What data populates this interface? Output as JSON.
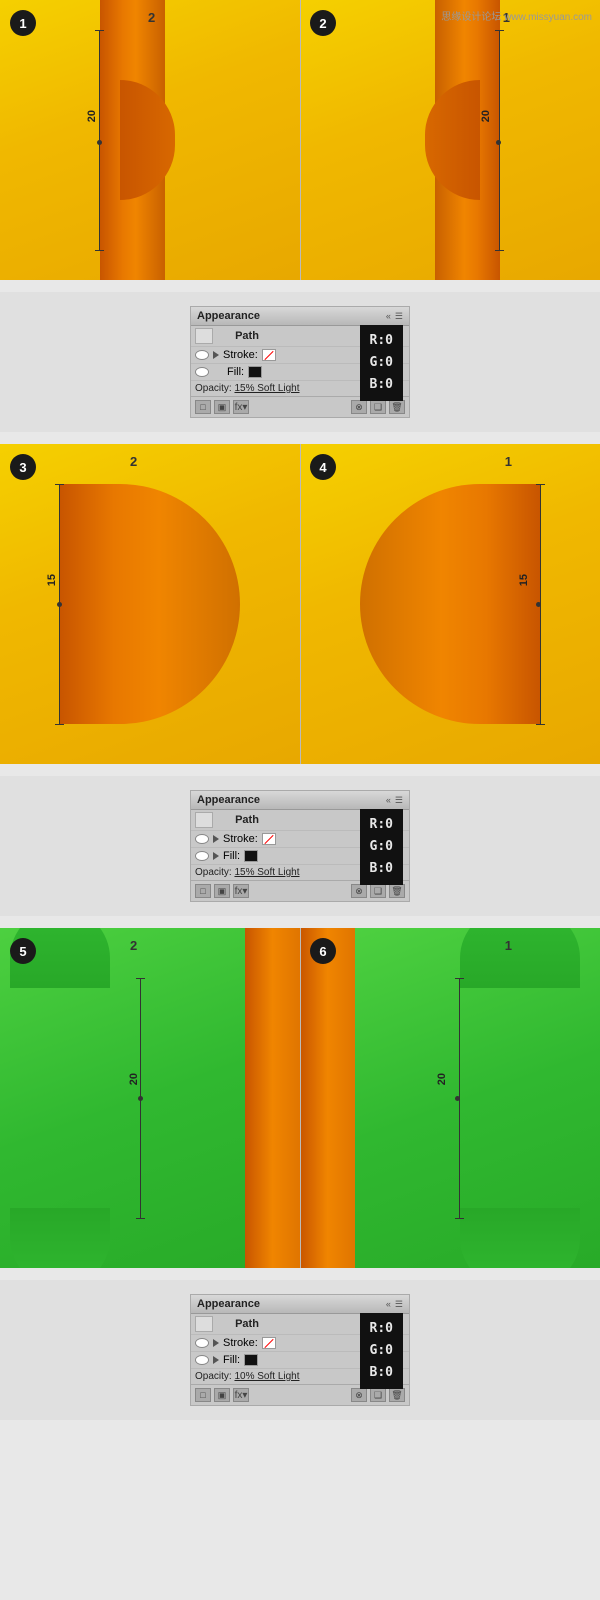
{
  "watermark": "思缘设计论坛 www.missyuan.com",
  "sections": [
    {
      "id": "section1",
      "diagrams": [
        {
          "step": "1",
          "numLabel": "2",
          "numPos": "top-right",
          "type": "yellow-orange-left",
          "dimValue": "20",
          "orientation": "left"
        },
        {
          "step": "2",
          "numLabel": "1",
          "numPos": "top-right",
          "type": "yellow-orange-right",
          "dimValue": "20",
          "orientation": "right"
        }
      ],
      "panel": {
        "title": "Appearance",
        "pathLabel": "Path",
        "strokeLabel": "Stroke:",
        "fillLabel": "Fill:",
        "opacityLabel": "Opacity:",
        "opacityValue": "15% Soft Light",
        "rgb": {
          "r": "R:0",
          "g": "G:0",
          "b": "B:0"
        }
      }
    },
    {
      "id": "section2",
      "diagrams": [
        {
          "step": "3",
          "numLabel": "2",
          "numPos": "top-left",
          "type": "yellow-orange-left-large",
          "dimValue": "15",
          "orientation": "left"
        },
        {
          "step": "4",
          "numLabel": "1",
          "numPos": "top-right",
          "type": "yellow-orange-right-large",
          "dimValue": "15",
          "orientation": "right"
        }
      ],
      "panel": {
        "title": "Appearance",
        "pathLabel": "Path",
        "strokeLabel": "Stroke:",
        "fillLabel": "Fill:",
        "opacityLabel": "Opacity:",
        "opacityValue": "15% Soft Light",
        "rgb": {
          "r": "R:0",
          "g": "G:0",
          "b": "B:0"
        }
      }
    },
    {
      "id": "section3",
      "diagrams": [
        {
          "step": "5",
          "numLabel": "2",
          "numPos": "top-left",
          "type": "green-orange-left",
          "dimValue": "20",
          "orientation": "left"
        },
        {
          "step": "6",
          "numLabel": "1",
          "numPos": "top-right",
          "type": "green-orange-right",
          "dimValue": "20",
          "orientation": "right"
        }
      ],
      "panel": {
        "title": "Appearance",
        "pathLabel": "Path",
        "strokeLabel": "Stroke:",
        "fillLabel": "Fill:",
        "opacityLabel": "Opacity:",
        "opacityValue": "10% Soft Light",
        "rgb": {
          "r": "R:0",
          "g": "G:0",
          "b": "B:0"
        }
      }
    }
  ]
}
